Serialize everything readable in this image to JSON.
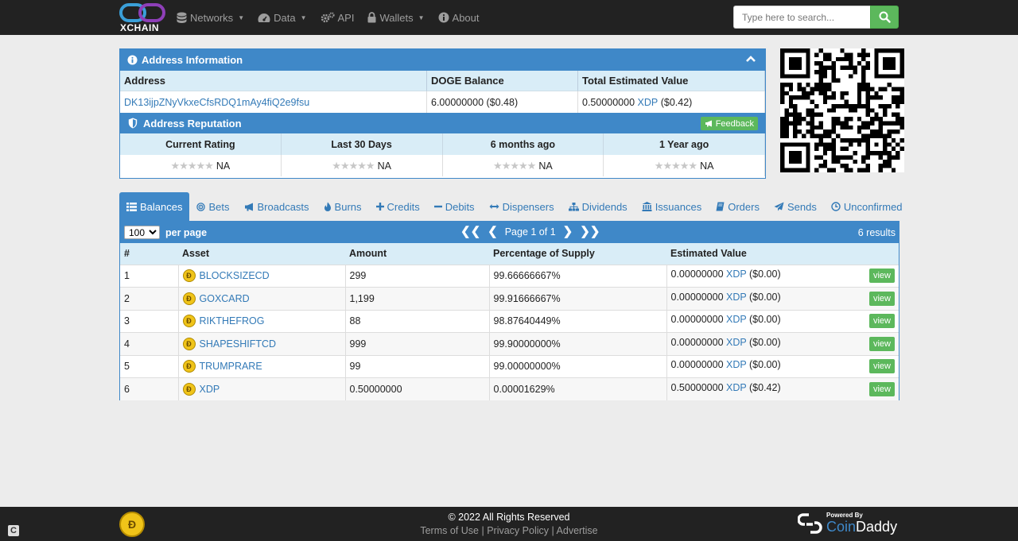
{
  "brand": {
    "logo_text": "XCHAIN"
  },
  "nav": {
    "items": [
      {
        "label": "Networks",
        "icon": "database-icon",
        "caret": true
      },
      {
        "label": "Data",
        "icon": "dashboard-icon",
        "caret": true
      },
      {
        "label": "API",
        "icon": "cogs-icon",
        "caret": false
      },
      {
        "label": "Wallets",
        "icon": "lock-icon",
        "caret": true
      },
      {
        "label": "About",
        "icon": "info-icon",
        "caret": false
      }
    ],
    "search_placeholder": "Type here to search..."
  },
  "address_info": {
    "title": "Address Information",
    "col_address": "Address",
    "col_balance": "DOGE Balance",
    "col_total": "Total Estimated Value",
    "address": "DK13ijpZNyVkxeCfsRDQ1mAy4fiQ2e9fsu",
    "balance": "6.00000000 ($0.48)",
    "total_value": "0.50000000",
    "total_asset": "XDP",
    "total_usd": "($0.42)"
  },
  "reputation": {
    "title": "Address Reputation",
    "feedback_label": "Feedback",
    "columns": [
      "Current Rating",
      "Last 30 Days",
      "6 months ago",
      "1 Year ago"
    ],
    "values": [
      "NA",
      "NA",
      "NA",
      "NA"
    ],
    "stars": "★★★★★"
  },
  "tabs": [
    {
      "label": "Balances",
      "icon": "list-icon",
      "active": true
    },
    {
      "label": "Bets",
      "icon": "bullseye-icon",
      "active": false
    },
    {
      "label": "Broadcasts",
      "icon": "bullhorn-icon",
      "active": false
    },
    {
      "label": "Burns",
      "icon": "fire-icon",
      "active": false
    },
    {
      "label": "Credits",
      "icon": "plus-icon",
      "active": false
    },
    {
      "label": "Debits",
      "icon": "minus-icon",
      "active": false
    },
    {
      "label": "Dispensers",
      "icon": "arrows-h-icon",
      "active": false
    },
    {
      "label": "Dividends",
      "icon": "sitemap-icon",
      "active": false
    },
    {
      "label": "Issuances",
      "icon": "bank-icon",
      "active": false
    },
    {
      "label": "Orders",
      "icon": "book-icon",
      "active": false
    },
    {
      "label": "Sends",
      "icon": "paper-plane-icon",
      "active": false
    },
    {
      "label": "Unconfirmed",
      "icon": "clock-icon",
      "active": false
    }
  ],
  "results": {
    "per_page_value": "100",
    "per_page_label": "per page",
    "page_text": "Page 1 of 1",
    "first_glyph": "❮❮",
    "prev_glyph": "❮",
    "next_glyph": "❯",
    "last_glyph": "❯❯",
    "count_text": "6 results",
    "headers": [
      "#",
      "Asset",
      "Amount",
      "Percentage of Supply",
      "Estimated Value"
    ],
    "view_label": "view",
    "rows": [
      {
        "num": "1",
        "asset": "BLOCKSIZECD",
        "amount": "299",
        "pct": "99.66666667%",
        "est": "0.00000000",
        "est_asset": "XDP",
        "est_usd": "($0.00)"
      },
      {
        "num": "2",
        "asset": "GOXCARD",
        "amount": "1,199",
        "pct": "99.91666667%",
        "est": "0.00000000",
        "est_asset": "XDP",
        "est_usd": "($0.00)"
      },
      {
        "num": "3",
        "asset": "RIKTHEFROG",
        "amount": "88",
        "pct": "98.87640449%",
        "est": "0.00000000",
        "est_asset": "XDP",
        "est_usd": "($0.00)"
      },
      {
        "num": "4",
        "asset": "SHAPESHIFTCD",
        "amount": "999",
        "pct": "99.90000000%",
        "est": "0.00000000",
        "est_asset": "XDP",
        "est_usd": "($0.00)"
      },
      {
        "num": "5",
        "asset": "TRUMPRARE",
        "amount": "99",
        "pct": "99.00000000%",
        "est": "0.00000000",
        "est_asset": "XDP",
        "est_usd": "($0.00)"
      },
      {
        "num": "6",
        "asset": "XDP",
        "amount": "0.50000000",
        "pct": "0.00001629%",
        "est": "0.50000000",
        "est_asset": "XDP",
        "est_usd": "($0.42)"
      }
    ]
  },
  "footer": {
    "copyright": "© 2022 All Rights Reserved",
    "links": [
      "Terms of Use",
      "Privacy Policy",
      "Advertise"
    ],
    "powered_by": "Powered By",
    "partner_a": "Coin",
    "partner_b": "Daddy"
  },
  "colors": {
    "nav_bg": "#222222",
    "panel_blue": "#3f88c8",
    "header_light": "#d9edf7",
    "link": "#337ab7",
    "button_green": "#5cb85c"
  }
}
